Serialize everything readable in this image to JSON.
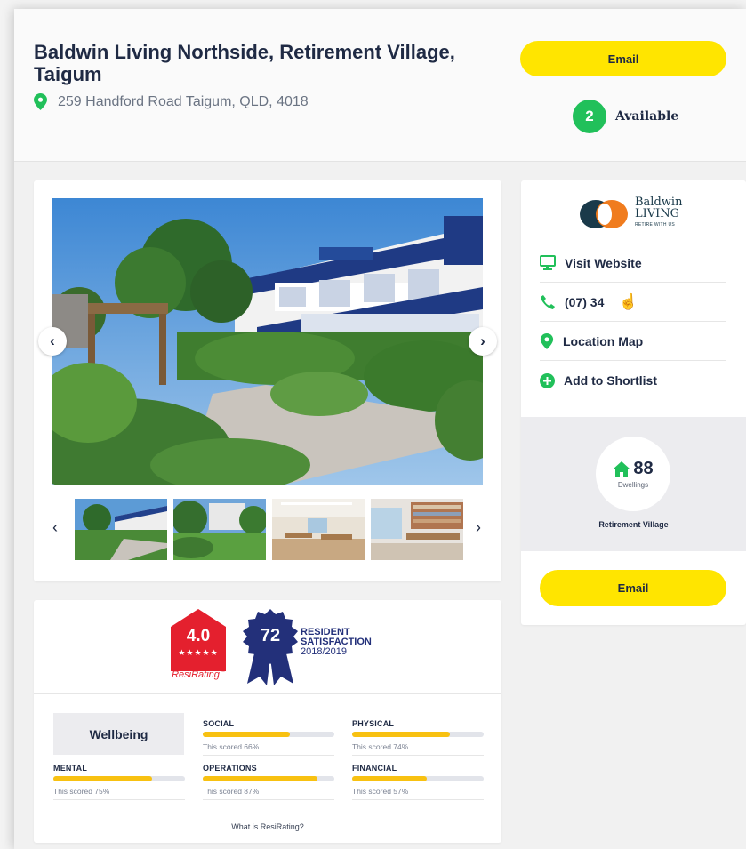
{
  "header": {
    "title": "Baldwin Living Northside, Retirement Village, Taigum",
    "address": "259 Handford Road Taigum, QLD, 4018",
    "email_label": "Email",
    "available_count": "2",
    "available_label": "Available"
  },
  "gallery": {
    "thumbnails": [
      "thumb-garden-building",
      "thumb-lawn-garden",
      "thumb-dining-room",
      "thumb-library-room"
    ]
  },
  "sidebar": {
    "logo_line1": "Baldwin",
    "logo_line2": "LIVING",
    "logo_tagline": "RETIRE WITH US",
    "visit_website": "Visit Website",
    "phone": "(07) 34",
    "location_map": "Location Map",
    "add_shortlist": "Add to Shortlist",
    "dwellings_count": "88",
    "dwellings_label": "Dwellings",
    "village_type": "Retirement Village",
    "email_label": "Email"
  },
  "rating": {
    "score": "4.0",
    "stars": "★★★★★",
    "brand": "ResiRating",
    "brand_tm": "™",
    "satisfaction_score": "72",
    "satisfaction_line1": "RESIDENT",
    "satisfaction_line2": "SATISFACTION",
    "satisfaction_year": "2018/2019",
    "category": "Wellbeing",
    "metrics": [
      {
        "name": "SOCIAL",
        "score_text": "This scored 66%",
        "value": 66
      },
      {
        "name": "PHYSICAL",
        "score_text": "This scored 74%",
        "value": 74
      },
      {
        "name": "MENTAL",
        "score_text": "This scored 75%",
        "value": 75
      },
      {
        "name": "OPERATIONS",
        "score_text": "This scored 87%",
        "value": 87
      },
      {
        "name": "FINANCIAL",
        "score_text": "This scored 57%",
        "value": 57
      }
    ],
    "what_is_link": "What is ResiRating?"
  },
  "colors": {
    "accent_yellow": "#ffe500",
    "green": "#21c05a",
    "navy": "#1f2a44",
    "rating_red": "#e4202e",
    "badge_navy": "#23307a",
    "bar_fill": "#f8c111"
  }
}
